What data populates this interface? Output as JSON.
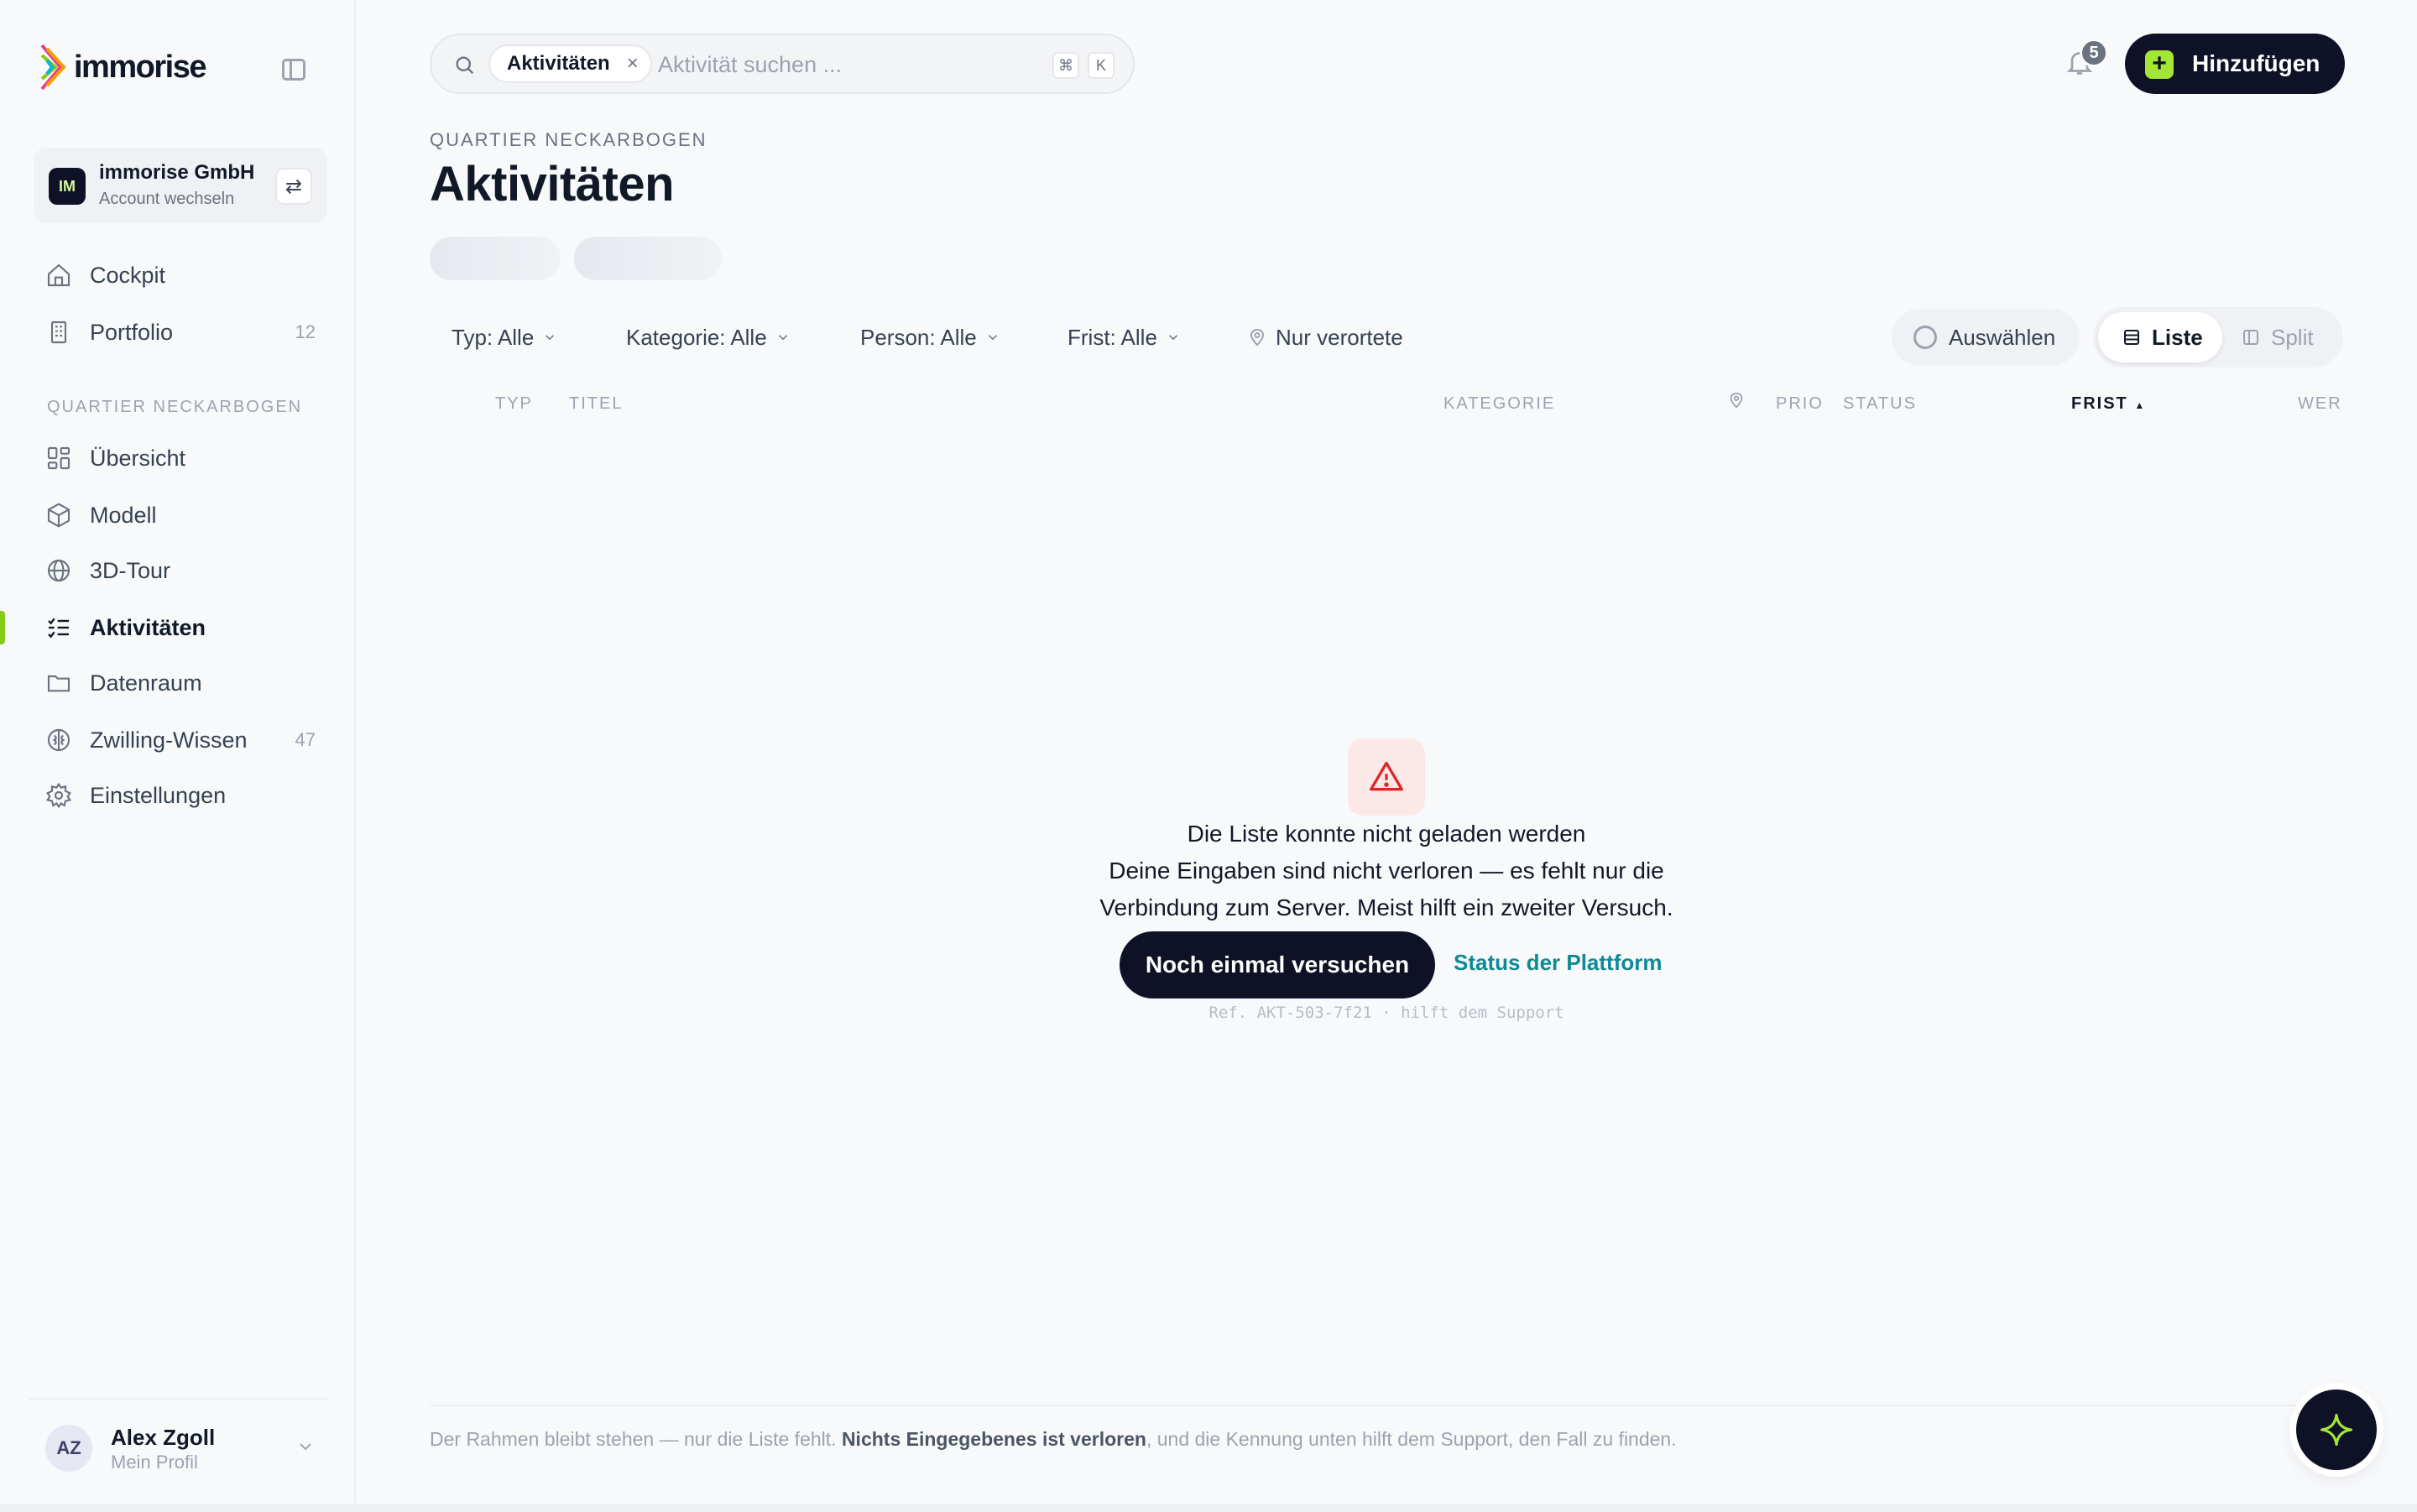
{
  "sidebar": {
    "brand": "immorise",
    "account": {
      "initials": "IM",
      "name": "immorise GmbH",
      "subtitle": "Account wechseln"
    },
    "top_items": [
      {
        "label": "Cockpit",
        "icon": "home-icon",
        "count": ""
      },
      {
        "label": "Portfolio",
        "icon": "building-icon",
        "count": "12"
      }
    ],
    "section_label": "QUARTIER NECKARBOGEN",
    "section_items": [
      {
        "label": "Übersicht",
        "icon": "grid-icon",
        "count": ""
      },
      {
        "label": "Modell",
        "icon": "cube-icon",
        "count": ""
      },
      {
        "label": "3D-Tour",
        "icon": "globe-icon",
        "count": ""
      },
      {
        "label": "Aktivitäten",
        "icon": "checklist-icon",
        "count": "",
        "active": true
      },
      {
        "label": "Datenraum",
        "icon": "folder-icon",
        "count": ""
      },
      {
        "label": "Zwilling-Wissen",
        "icon": "brain-icon",
        "count": "47"
      },
      {
        "label": "Einstellungen",
        "icon": "gear-icon",
        "count": ""
      }
    ],
    "profile": {
      "initials": "AZ",
      "name": "Alex Zgoll",
      "subtitle": "Mein Profil"
    }
  },
  "header": {
    "search_chip": "Aktivitäten",
    "search_placeholder": "Aktivität suchen ...",
    "shortcut_keys": [
      "⌘",
      "K"
    ],
    "notification_count": "5",
    "add_label": "Hinzufügen"
  },
  "page": {
    "breadcrumb": "QUARTIER NECKARBOGEN",
    "title": "Aktivitäten"
  },
  "filters": [
    {
      "label": "Typ: Alle"
    },
    {
      "label": "Kategorie: Alle"
    },
    {
      "label": "Person: Alle"
    },
    {
      "label": "Frist: Alle"
    }
  ],
  "located_only": "Nur verortete",
  "select_label": "Auswählen",
  "view_toggle": {
    "active": "Liste",
    "inactive": "Split"
  },
  "table_headers": {
    "type": "TYP",
    "title": "TITEL",
    "category": "KATEGORIE",
    "prio": "PRIO",
    "status": "STATUS",
    "deadline": "FRIST",
    "sort_indicator": "▲",
    "who": "WER"
  },
  "error": {
    "title": "Die Liste konnte nicht geladen werden",
    "line1": "Deine Eingaben sind nicht verloren — es fehlt nur die",
    "line2": "Verbindung zum Server. Meist hilft ein zweiter Versuch.",
    "retry_label": "Noch einmal versuchen",
    "status_link": "Status der Plattform",
    "reference": "Ref. AKT-503-7f21 · hilft dem Support"
  },
  "footer": {
    "before": "Der Rahmen bleibt stehen — nur die Liste fehlt. ",
    "bold": "Nichts Eingegebenes ist verloren",
    "after": ", und die Kennung unten hilft dem Support, den Fall zu finden."
  },
  "colors": {
    "brand_dark": "#0f1226",
    "accent_green": "#a3e635",
    "active_bar": "#84cc16",
    "link_teal": "#0e8a94",
    "error_bg": "#fde8e8",
    "error_red": "#dc2626"
  }
}
